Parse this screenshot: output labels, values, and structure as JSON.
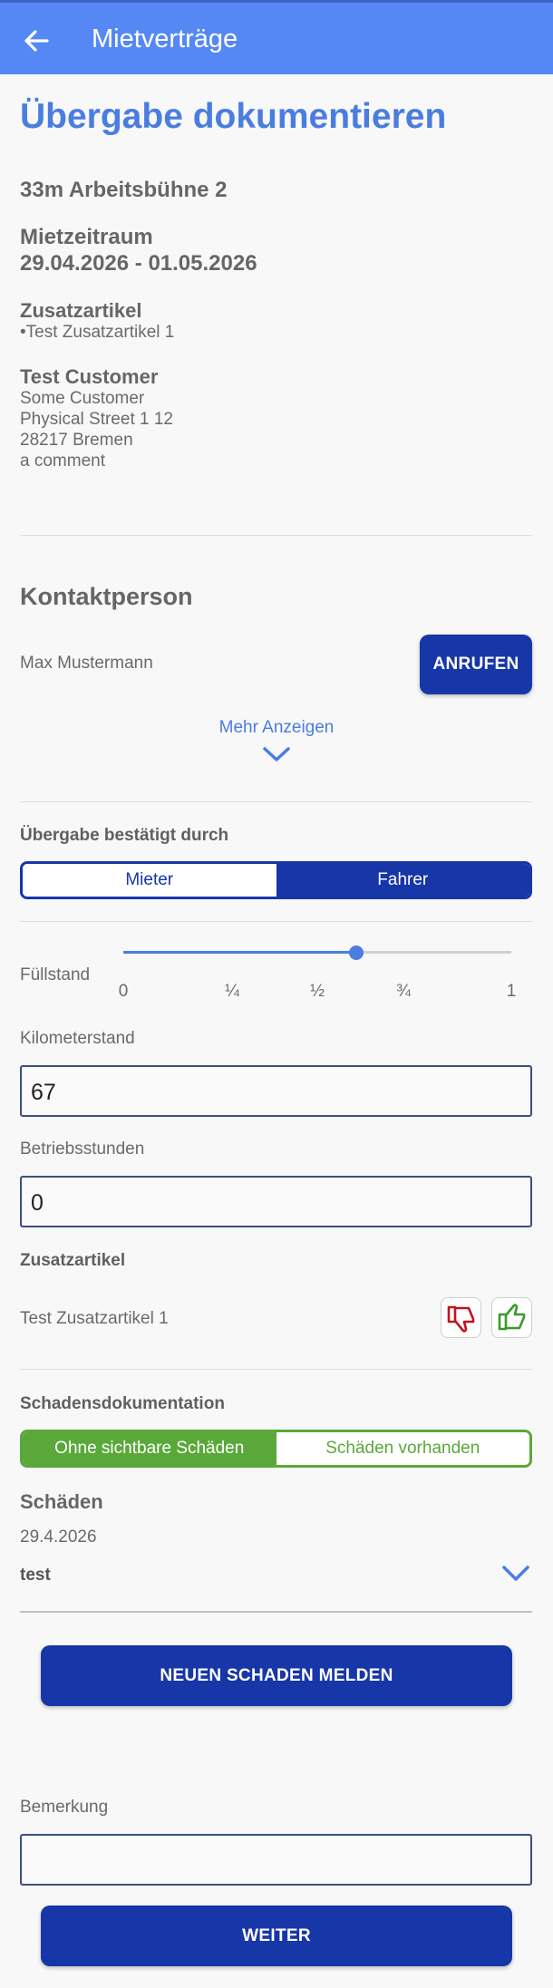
{
  "appbar": {
    "title": "Mietverträge",
    "back_icon": "arrow-left-icon"
  },
  "page": {
    "title": "Übergabe dokumentieren",
    "machine": "33m Arbeitsbühne 2",
    "period_label": "Mietzeitraum",
    "period_value": "29.04.2026 - 01.05.2026",
    "extras_label": "Zusatzartikel",
    "extras_item": "•Test Zusatzartikel 1",
    "customer_name": "Test Customer",
    "customer_lines": [
      "Some Customer",
      "Physical Street 1 12",
      "28217 Bremen",
      "a comment"
    ]
  },
  "contact": {
    "heading": "Kontaktperson",
    "name": "Max Mustermann",
    "call_label": "ANRUFEN",
    "more_label": "Mehr Anzeigen"
  },
  "handover": {
    "label": "Übergabe bestätigt durch",
    "options": [
      "Mieter",
      "Fahrer"
    ],
    "selected": "Fahrer"
  },
  "fuel": {
    "label": "Füllstand",
    "ticks": [
      "0",
      "¼",
      "½",
      "¾",
      "1"
    ],
    "value": 0.6
  },
  "mileage": {
    "label": "Kilometerstand",
    "value": "67"
  },
  "hours": {
    "label": "Betriebsstunden",
    "value": "0"
  },
  "extras_check": {
    "heading": "Zusatzartikel",
    "item": "Test Zusatzartikel 1",
    "thumbs_down_icon": "thumbs-down-icon",
    "thumbs_up_icon": "thumbs-up-icon"
  },
  "damage": {
    "heading": "Schadensdokumentation",
    "options": [
      "Ohne sichtbare Schäden",
      "Schäden vorhanden"
    ],
    "selected": "Ohne sichtbare Schäden",
    "list_heading": "Schäden",
    "date": "29.4.2026",
    "entry": "test",
    "report_label": "NEUEN SCHADEN MELDEN"
  },
  "remark": {
    "label": "Bemerkung",
    "value": ""
  },
  "next_label": "WEITER",
  "colors": {
    "primary": "#1736a8",
    "accent": "#4a7de0",
    "appbar": "#5588f5",
    "green": "#5aa83a",
    "red": "#c0141e"
  }
}
